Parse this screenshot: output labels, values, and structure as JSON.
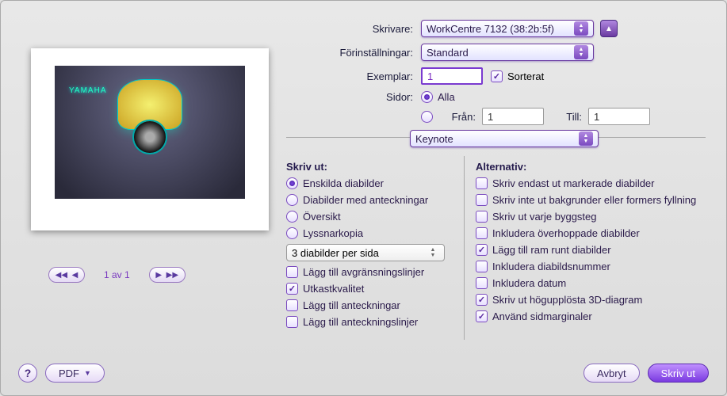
{
  "labels": {
    "printer": "Skrivare:",
    "presets": "Förinställningar:",
    "copies": "Exemplar:",
    "collated": "Sorterat",
    "pages": "Sidor:",
    "all": "Alla",
    "from": "Från:",
    "to": "Till:"
  },
  "values": {
    "printer": "WorkCentre 7132 (38:2b:5f)",
    "preset": "Standard",
    "copies": "1",
    "from": "1",
    "to": "1",
    "section": "Keynote",
    "preview_text": "YAMAHA"
  },
  "pager": {
    "label": "1 av 1"
  },
  "print": {
    "heading": "Skriv ut:",
    "radios": [
      "Enskilda diabilder",
      "Diabilder med anteckningar",
      "Översikt",
      "Lyssnarkopia"
    ],
    "per_page": "3 diabilder per sida",
    "checks": [
      {
        "label": "Lägg till avgränsningslinjer",
        "checked": false
      },
      {
        "label": "Utkastkvalitet",
        "checked": true
      },
      {
        "label": "Lägg till anteckningar",
        "checked": false
      },
      {
        "label": "Lägg till anteckningslinjer",
        "checked": false
      }
    ]
  },
  "options": {
    "heading": "Alternativ:",
    "items": [
      {
        "label": "Skriv endast ut markerade diabilder",
        "checked": false
      },
      {
        "label": "Skriv inte ut bakgrunder eller formers fyllning",
        "checked": false
      },
      {
        "label": "Skriv ut varje byggsteg",
        "checked": false
      },
      {
        "label": "Inkludera överhoppade diabilder",
        "checked": false
      },
      {
        "label": "Lägg till ram runt diabilder",
        "checked": true
      },
      {
        "label": "Inkludera diabildsnummer",
        "checked": false
      },
      {
        "label": "Inkludera datum",
        "checked": false
      },
      {
        "label": "Skriv ut högupplösta 3D-diagram",
        "checked": true
      },
      {
        "label": "Använd sidmarginaler",
        "checked": true
      }
    ]
  },
  "footer": {
    "pdf": "PDF",
    "cancel": "Avbryt",
    "print": "Skriv ut"
  }
}
